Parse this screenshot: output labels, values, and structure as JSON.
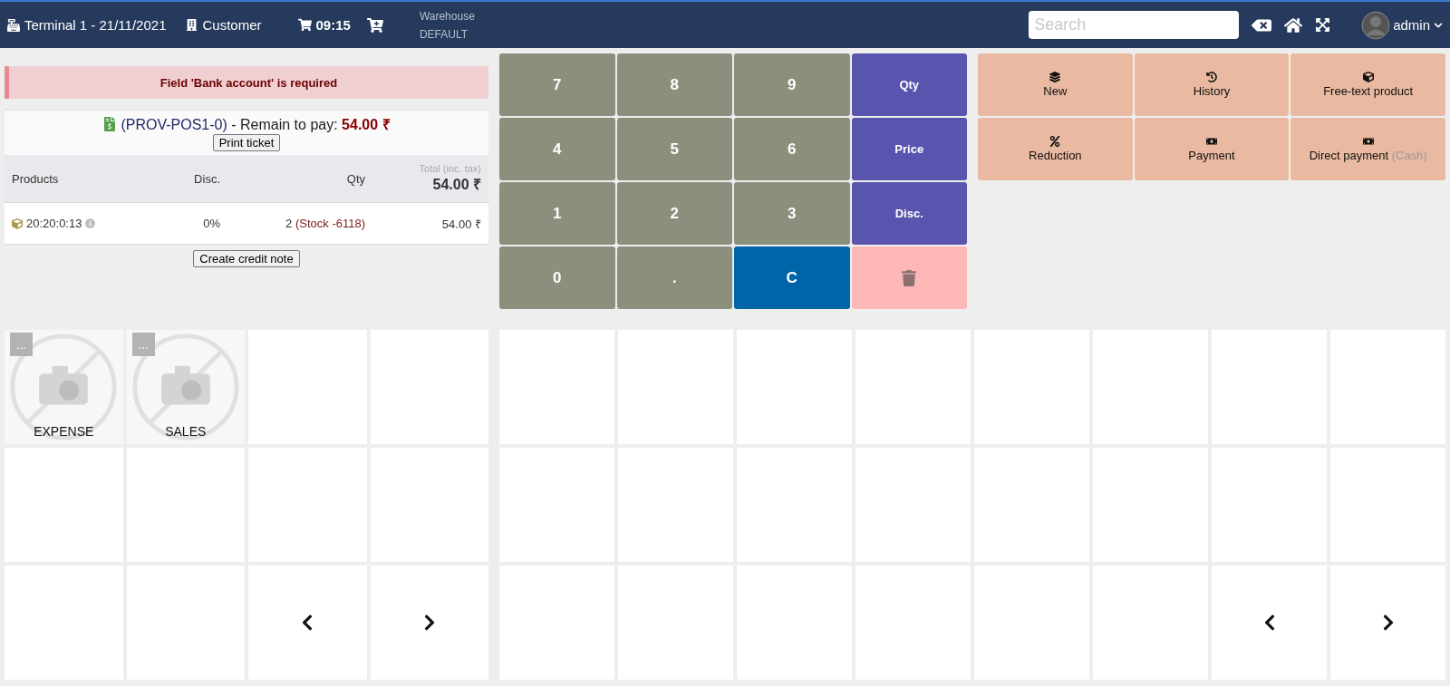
{
  "header": {
    "terminal": "Terminal 1 - 21/11/2021",
    "customer": "Customer",
    "time": "09:15",
    "warehouse_label": "Warehouse",
    "warehouse": "DEFAULT",
    "search": {
      "placeholder": "Search"
    },
    "user": "admin"
  },
  "alert": "Field 'Bank account' is required",
  "ticket": {
    "ref": "(PROV-POS1-0)",
    "remain_label": " - Remain to pay: ",
    "remain": "54.00 ₹",
    "print_button": "Print ticket"
  },
  "table": {
    "columns": [
      "Products",
      "Disc.",
      "Qty",
      "Total (inc. tax)"
    ],
    "total": "54.00 ₹",
    "rows": [
      {
        "product": "20:20:0:13",
        "disc": "0%",
        "qty": "2",
        "stock": "(Stock -6118)",
        "total": "54.00 ₹"
      }
    ]
  },
  "credit_note_button": "Create credit note",
  "keypad": [
    {
      "kind": "digit",
      "label": "7"
    },
    {
      "kind": "digit",
      "label": "8"
    },
    {
      "kind": "digit",
      "label": "9"
    },
    {
      "kind": "mode",
      "label": "Qty"
    },
    {
      "kind": "digit",
      "label": "4"
    },
    {
      "kind": "digit",
      "label": "5"
    },
    {
      "kind": "digit",
      "label": "6"
    },
    {
      "kind": "mode",
      "label": "Price"
    },
    {
      "kind": "digit",
      "label": "1"
    },
    {
      "kind": "digit",
      "label": "2"
    },
    {
      "kind": "digit",
      "label": "3"
    },
    {
      "kind": "mode",
      "label": "Disc."
    },
    {
      "kind": "digit",
      "label": "0"
    },
    {
      "kind": "digit",
      "label": "."
    },
    {
      "kind": "clear",
      "label": "C"
    },
    {
      "kind": "delete"
    }
  ],
  "actions": [
    {
      "kind": "layers",
      "label": "New"
    },
    {
      "kind": "history",
      "label": "History"
    },
    {
      "kind": "cube",
      "label": "Free-text product"
    },
    {
      "kind": "percent",
      "label": "Reduction"
    },
    {
      "kind": "money",
      "label": "Payment"
    },
    {
      "kind": "money",
      "label": "Direct payment",
      "note": "(Cash)"
    }
  ],
  "categories": [
    {
      "kind": "category",
      "label": "EXPENSE",
      "more": "..."
    },
    {
      "kind": "category",
      "label": "SALES",
      "more": "..."
    },
    {
      "kind": "empty"
    },
    {
      "kind": "empty"
    },
    {
      "kind": "empty"
    },
    {
      "kind": "empty"
    },
    {
      "kind": "empty"
    },
    {
      "kind": "empty"
    },
    {
      "kind": "empty"
    },
    {
      "kind": "empty"
    },
    {
      "kind": "prev"
    },
    {
      "kind": "next"
    }
  ],
  "products": [
    {
      "kind": "empty"
    },
    {
      "kind": "empty"
    },
    {
      "kind": "empty"
    },
    {
      "kind": "empty"
    },
    {
      "kind": "empty"
    },
    {
      "kind": "empty"
    },
    {
      "kind": "empty"
    },
    {
      "kind": "empty"
    },
    {
      "kind": "empty"
    },
    {
      "kind": "empty"
    },
    {
      "kind": "empty"
    },
    {
      "kind": "empty"
    },
    {
      "kind": "empty"
    },
    {
      "kind": "empty"
    },
    {
      "kind": "empty"
    },
    {
      "kind": "empty"
    },
    {
      "kind": "empty"
    },
    {
      "kind": "empty"
    },
    {
      "kind": "empty"
    },
    {
      "kind": "empty"
    },
    {
      "kind": "empty"
    },
    {
      "kind": "empty"
    },
    {
      "kind": "prev"
    },
    {
      "kind": "next"
    }
  ]
}
